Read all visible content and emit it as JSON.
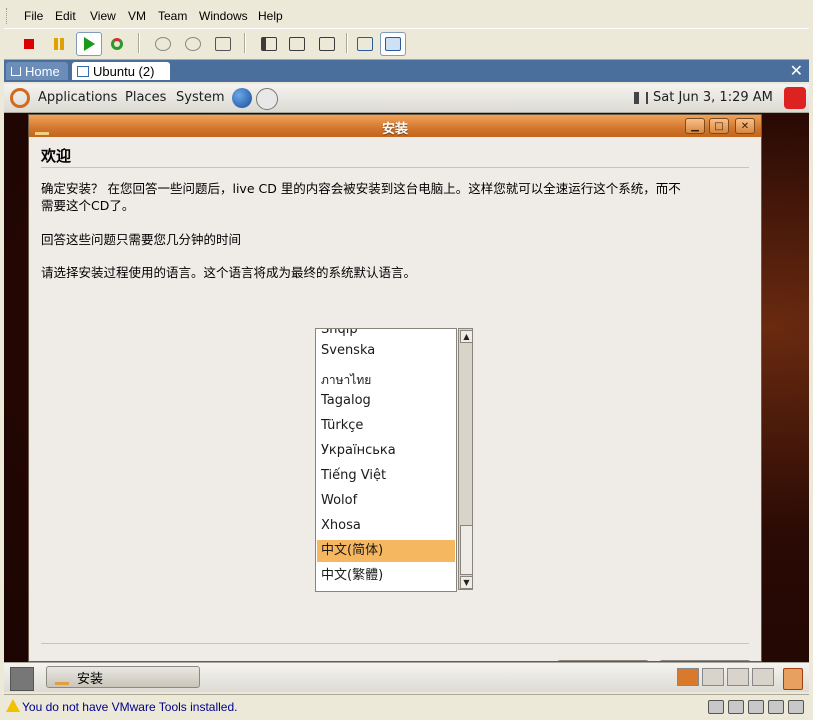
{
  "vmware": {
    "menu": [
      "File",
      "Edit",
      "View",
      "VM",
      "Team",
      "Windows",
      "Help"
    ],
    "tabs": {
      "home": "Home",
      "active": "Ubuntu (2)",
      "close": "✕"
    },
    "status_text": "You do not have VMware Tools installed."
  },
  "gnome": {
    "menus": [
      "Applications",
      "Places",
      "System"
    ],
    "clock": "Sat Jun  3,  1:29 AM"
  },
  "installer": {
    "title": "安装",
    "heading": "欢迎",
    "para1": "确定安装？ 在您回答一些问题后，live CD 里的内容会被安装到这台电脑上。这样您就可以全速运行这个系统，而不需要这个CD了。",
    "para2": "回答这些问题只需要您几分钟的时间",
    "para3": "请选择安装过程使用的语言。这个语言将成为最终的系统默认语言。",
    "languages": [
      "Shqip",
      "Svenska",
      "ภาษาไทย",
      "Tagalog",
      "Türkçe",
      "Українська",
      "Tiếng Việt",
      "Wolof",
      "Xhosa",
      "中文(简体)",
      "中文(繁體)"
    ],
    "selected_language": "中文(简体)"
  },
  "taskbar": {
    "window_button": "安装"
  },
  "colors": {
    "title_orange": "#d2762e",
    "selection": "#f5b760",
    "status_blue": "#00008b"
  }
}
